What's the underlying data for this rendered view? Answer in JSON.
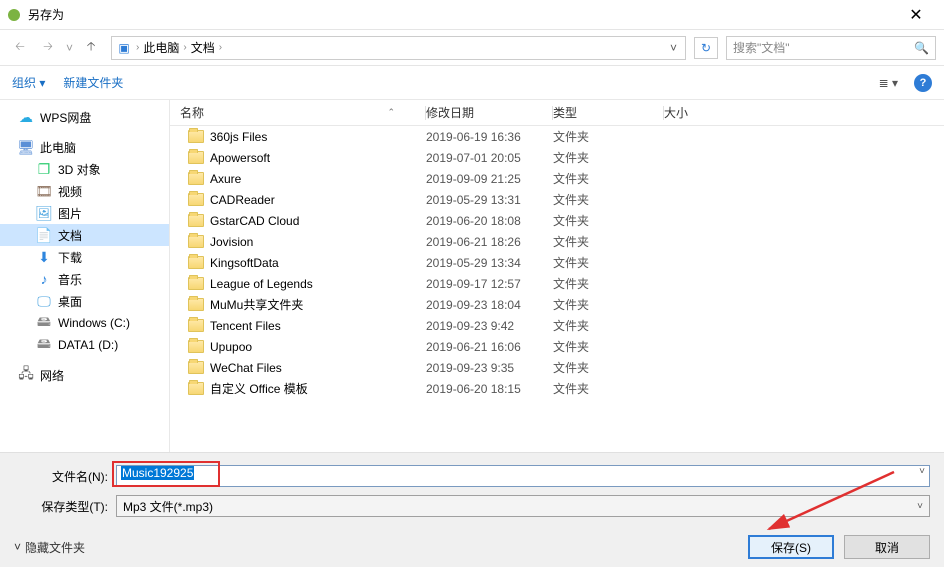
{
  "title": "另存为",
  "breadcrumb": {
    "root": "此电脑",
    "folder": "文档"
  },
  "search_placeholder": "搜索\"文档\"",
  "toolbar": {
    "organize": "组织",
    "new_folder": "新建文件夹"
  },
  "sidebar": {
    "wps": "WPS网盘",
    "pc": "此电脑",
    "d3": "3D 对象",
    "video": "视频",
    "pic": "图片",
    "doc": "文档",
    "dl": "下载",
    "music": "音乐",
    "desktop": "桌面",
    "drive_c": "Windows (C:)",
    "drive_d": "DATA1 (D:)",
    "network": "网络"
  },
  "columns": {
    "name": "名称",
    "date": "修改日期",
    "type": "类型",
    "size": "大小"
  },
  "rows": [
    {
      "name": "360js Files",
      "date": "2019-06-19 16:36",
      "type": "文件夹"
    },
    {
      "name": "Apowersoft",
      "date": "2019-07-01 20:05",
      "type": "文件夹"
    },
    {
      "name": "Axure",
      "date": "2019-09-09 21:25",
      "type": "文件夹"
    },
    {
      "name": "CADReader",
      "date": "2019-05-29 13:31",
      "type": "文件夹"
    },
    {
      "name": "GstarCAD Cloud",
      "date": "2019-06-20 18:08",
      "type": "文件夹"
    },
    {
      "name": "Jovision",
      "date": "2019-06-21 18:26",
      "type": "文件夹"
    },
    {
      "name": "KingsoftData",
      "date": "2019-05-29 13:34",
      "type": "文件夹"
    },
    {
      "name": "League of Legends",
      "date": "2019-09-17 12:57",
      "type": "文件夹"
    },
    {
      "name": "MuMu共享文件夹",
      "date": "2019-09-23 18:04",
      "type": "文件夹"
    },
    {
      "name": "Tencent Files",
      "date": "2019-09-23 9:42",
      "type": "文件夹"
    },
    {
      "name": "Upupoo",
      "date": "2019-06-21 16:06",
      "type": "文件夹"
    },
    {
      "name": "WeChat Files",
      "date": "2019-09-23 9:35",
      "type": "文件夹"
    },
    {
      "name": "自定义 Office 模板",
      "date": "2019-06-20 18:15",
      "type": "文件夹"
    }
  ],
  "labels": {
    "filename": "文件名(N):",
    "filetype": "保存类型(T):",
    "hide_folders": "隐藏文件夹",
    "save": "保存(S)",
    "cancel": "取消"
  },
  "filename_value": "Music192925",
  "filetype_value": "Mp3 文件(*.mp3)"
}
